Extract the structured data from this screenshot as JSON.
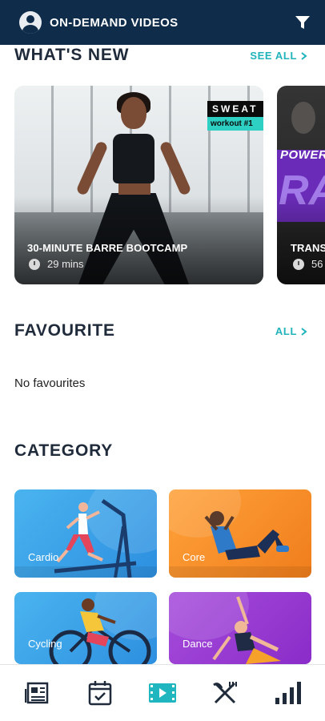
{
  "header": {
    "title": "ON-DEMAND VIDEOS",
    "avatar_icon": "user-avatar-icon",
    "filter_icon": "filter-icon"
  },
  "whats_new": {
    "title": "WHAT'S NEW",
    "link": "SEE ALL",
    "cards": [
      {
        "title": "30-MINUTE BARRE BOOTCAMP",
        "duration": "29 mins",
        "badge_top": "SWEAT",
        "badge_bottom": "workout #1"
      },
      {
        "title": "TRANS",
        "duration": "56",
        "overlay_top": "POWER",
        "overlay_big": "RA"
      }
    ]
  },
  "favourite": {
    "title": "FAVOURITE",
    "link": "ALL",
    "empty_text": "No favourites"
  },
  "category": {
    "title": "CATEGORY",
    "tiles": [
      {
        "label": "Cardio"
      },
      {
        "label": "Core"
      },
      {
        "label": "Cycling"
      },
      {
        "label": "Dance"
      }
    ]
  },
  "bottom_nav": {
    "items": [
      "news-icon",
      "calendar-icon",
      "video-icon",
      "fork-knife-icon",
      "stats-icon"
    ],
    "active_index": 2
  },
  "colors": {
    "header_bg": "#0f2c4a",
    "accent": "#20b3bb",
    "nav_active": "#1fb6bf",
    "nav_inactive": "#1f2a3a"
  }
}
